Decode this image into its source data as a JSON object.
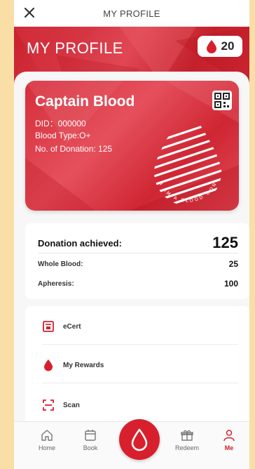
{
  "navbar": {
    "title": "MY PROFILE",
    "close_icon": "close-icon"
  },
  "header": {
    "title": "MY PROFILE",
    "points": "20"
  },
  "card": {
    "name": "Captain Blood",
    "did": "DID：000000",
    "blood_type": "Blood Type:O+",
    "donations": "No. of Donation: 125",
    "slogan": "I AM A BLOOD DONOR"
  },
  "stats": {
    "achieved_label": "Donation achieved:",
    "achieved_value": "125",
    "whole_label": "Whole Blood:",
    "whole_value": "25",
    "apheresis_label": "Apheresis:",
    "apheresis_value": "100"
  },
  "menu": {
    "items": [
      {
        "label": "eCert",
        "icon": "certificate-icon"
      },
      {
        "label": "My Rewards",
        "icon": "blood-drop-icon"
      },
      {
        "label": "Scan",
        "icon": "scan-icon"
      }
    ]
  },
  "tabs": [
    {
      "label": "Home",
      "icon": "home-icon"
    },
    {
      "label": "Book",
      "icon": "calendar-icon"
    },
    {
      "label": "Redeem",
      "icon": "gift-icon"
    },
    {
      "label": "Me",
      "icon": "person-icon"
    }
  ],
  "colors": {
    "brand_red": "#d81f2e",
    "background": "#f9dfa6"
  }
}
